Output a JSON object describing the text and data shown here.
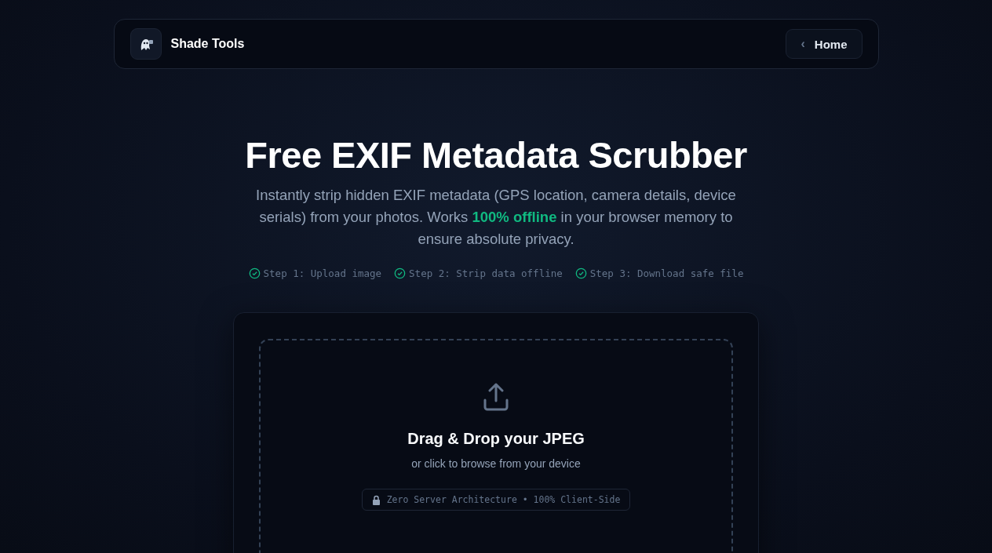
{
  "header": {
    "brand": "Shade Tools",
    "nav_button": {
      "icon": "‹",
      "label": "Home"
    }
  },
  "hero": {
    "title": "Free EXIF Metadata Scrubber",
    "subtitle": "Instantly strip hidden EXIF metadata (GPS location, camera details, device serials) from your photos. Works **100% offline** in your browser memory to ensure absolute privacy.",
    "steps": [
      {
        "label": "Step 1: Upload image",
        "done": true
      },
      {
        "label": "Step 2: Strip data offline",
        "done": true
      },
      {
        "label": "Step 3: Download safe file",
        "done": true
      }
    ]
  },
  "dropzone": {
    "title": "Drag & Drop your JPEG",
    "hint": "or click to browse from your device",
    "badge": "Zero Server Architecture • 100% Client-Side"
  }
}
